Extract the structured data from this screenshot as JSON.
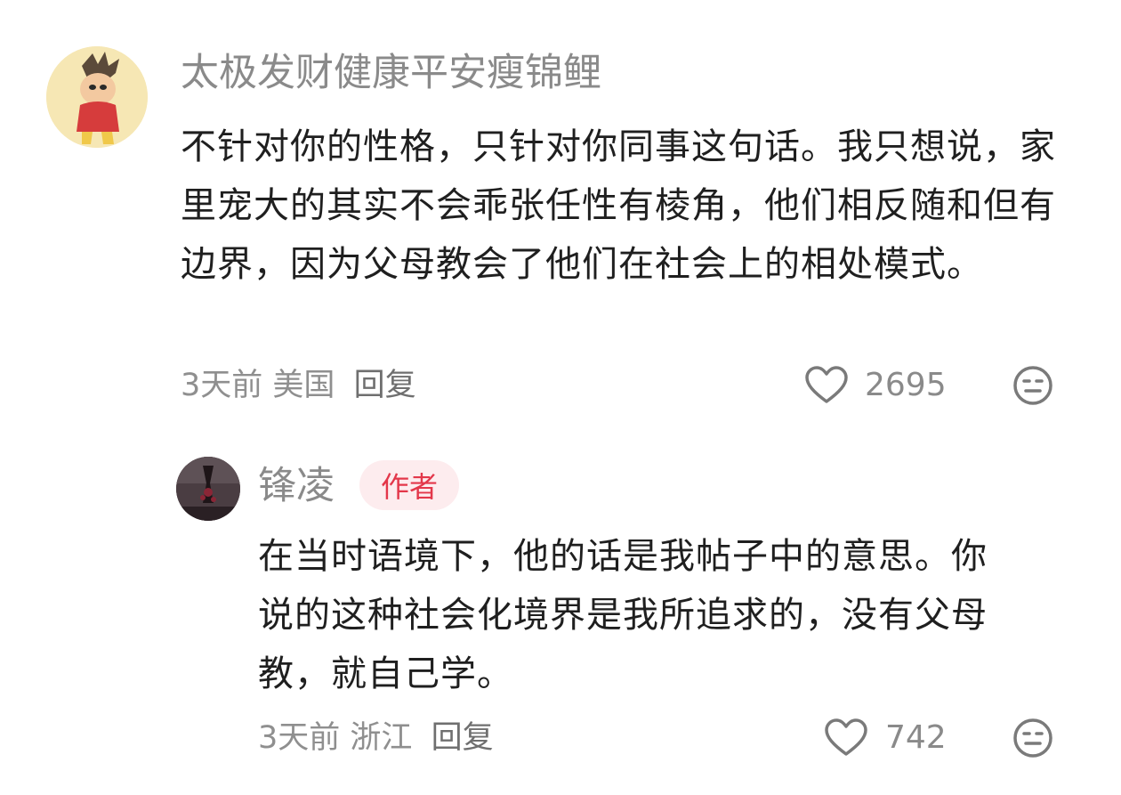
{
  "comments": [
    {
      "username": "太极发财健康平安瘦锦鲤",
      "text": "不针对你的性格，只针对你同事这句话。我只想说，家里宠大的其实不会乖张任性有棱角，他们相反随和但有边界，因为父母教会了他们在社会上的相处模式。",
      "time": "3天前",
      "location": "美国",
      "reply_label": "回复",
      "likes": "2695",
      "avatar_icon": "cartoon-character-avatar",
      "like_icon": "heart-outline-icon",
      "dislike_icon": "neutral-face-icon"
    },
    {
      "username": "锋凌",
      "badge": "作者",
      "text": "在当时语境下，他的话是我帖子中的意思。你说的这种社会化境界是我所追求的，没有父母教，就自己学。",
      "time": "3天前",
      "location": "浙江",
      "reply_label": "回复",
      "likes": "742",
      "avatar_icon": "dark-photo-avatar",
      "like_icon": "heart-outline-icon",
      "dislike_icon": "neutral-face-icon"
    }
  ],
  "colors": {
    "badge_bg": "#fdecee",
    "badge_text": "#e3374a",
    "username": "#8a8a8a",
    "body_text": "#1f1f1f"
  }
}
